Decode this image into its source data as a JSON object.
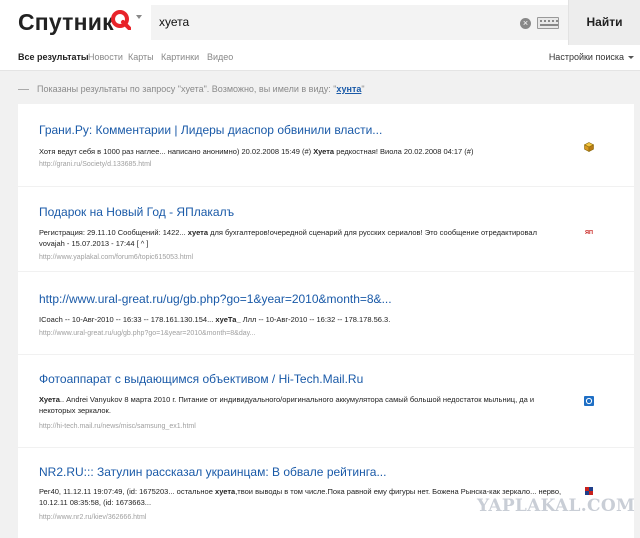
{
  "header": {
    "logo_text": "Спутник",
    "logo_icon": "sputnik-q-icon",
    "query": "хуета",
    "clear_icon": "clear-icon",
    "keyboard_icon": "keyboard-icon",
    "find_label": "Найти",
    "accent": "#e8232a"
  },
  "tabs": {
    "items": [
      "Все результаты",
      "Новости",
      "Карты",
      "Картинки",
      "Видео"
    ],
    "settings_label": "Настройки поиска"
  },
  "notice": {
    "text": "Показаны результаты по запросу \"хуета\". Возможно, вы имели в виду: \"",
    "suggest": "хунта",
    "tail": "\""
  },
  "results": [
    {
      "title": "Грани.Ру: Комментарии | Лидеры диаспор обвинили власти...",
      "snippet_parts": [
        "Хотя ведут себя в 1000 раз наглее... написано анонимно) 20.02.2008 15:49 (#) ",
        "Хуета",
        " редкостная! Виола 20.02.2008 04:17 (#)"
      ],
      "url": "http://grani.ru/Society/d.133685.html",
      "favicon": "box-icon"
    },
    {
      "title": "Подарок на Новый Год - ЯПлакалъ",
      "snippet_parts": [
        "Регистрация: 29.11.10 Сообщений: 1422... ",
        "хуета",
        " для бухгалтеров!очередной сценарий для русских сериалов! Это сообщение отредактировал vovajah - 15.07.2013 - 17:44 [ ^ ]"
      ],
      "url": "http://www.yaplakal.com/forum6/topic615053.html",
      "favicon": "yap-icon"
    },
    {
      "title": "http://www.ural-great.ru/ug/gb.php?go=1&year=2010&month=8&...",
      "snippet_parts": [
        "ICoach -- 10-Авг-2010 -- 16:33 -- 178.161.130.154... ",
        "хуеТа_",
        " Ллл -- 10-Авг-2010 -- 16:32 -- 178.178.56.3."
      ],
      "url": "http://www.ural-great.ru/ug/gb.php?go=1&year=2010&month=8&day...",
      "favicon": ""
    },
    {
      "title": "Фотоаппарат с выдающимся объективом / Hi-Tech.Mail.Ru",
      "snippet_parts": [
        "",
        "Хуета",
        ".. Andrei Vanyukov 8 марта 2010 г. Питание от индивидуального/оригинального аккумулятора самый большой недостаток мыльниц, да и некоторых зеркалок."
      ],
      "url": "http://hi-tech.mail.ru/news/misc/samsung_ex1.html",
      "favicon": "mail-icon"
    },
    {
      "title": "NR2.RU::: Затулин рассказал украинцам: В обвале рейтинга...",
      "snippet_parts": [
        "Рег40, 11.12.11 19:07:49, (id: 1675203... остальное ",
        "хуета",
        ",твои выводы в том числе.Пока равной ему фигуры нет. Божена Рынска-как зеркало... нерво, 10.12.11 08:35:58, (id: 1673663..."
      ],
      "url": "http://www.nr2.ru/kiev/362666.html",
      "favicon": "nr2-icon"
    }
  ],
  "watermark": "YAPLAKAL.COM"
}
